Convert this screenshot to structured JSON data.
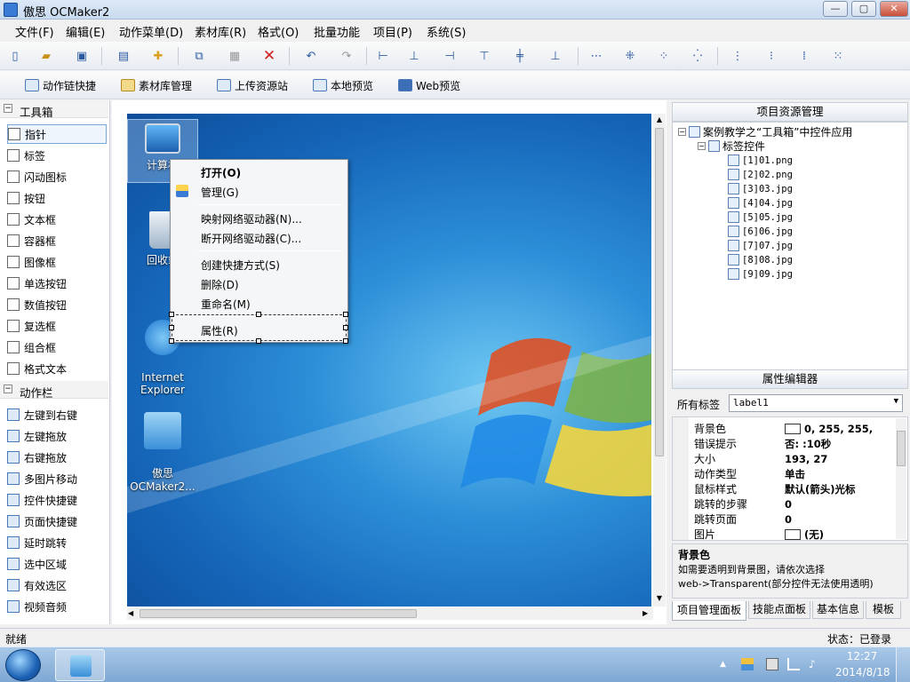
{
  "window": {
    "title": "傲思 OCMaker2"
  },
  "menu": [
    "文件(F)",
    "编辑(E)",
    "动作菜单(D)",
    "素材库(R)",
    "格式(O)",
    "批量功能",
    "项目(P)",
    "系统(S)"
  ],
  "toolbar2": [
    "动作链快捷",
    "素材库管理",
    "上传资源站",
    "本地预览",
    "Web预览"
  ],
  "toolbox": {
    "group1": "工具箱",
    "items1": [
      "指针",
      "标签",
      "闪动图标",
      "按钮",
      "文本框",
      "容器框",
      "图像框",
      "单选按钮",
      "数值按钮",
      "复选框",
      "组合框",
      "格式文本"
    ],
    "icons1": [
      "pointer-icon",
      "label-icon",
      "flash-icon",
      "button-icon",
      "textbox-icon",
      "container-icon",
      "image-icon",
      "radio-icon",
      "number-icon",
      "checkbox-icon",
      "combo-icon",
      "richtext-icon"
    ],
    "group2": "动作栏",
    "items2": [
      "左键到右键",
      "左键拖放",
      "右键拖放",
      "多图片移动",
      "控件快捷键",
      "页面快捷键",
      "延时跳转",
      "选中区域",
      "有效选区",
      "视频音频"
    ]
  },
  "desktop": {
    "icons": [
      "计算机",
      "回收站",
      "Internet\nExplorer",
      "傲思\nOCMaker2..."
    ]
  },
  "context_menu": {
    "items": [
      "打开(O)",
      "管理(G)",
      "映射网络驱动器(N)...",
      "断开网络驱动器(C)...",
      "创建快捷方式(S)",
      "删除(D)",
      "重命名(M)",
      "属性(R)"
    ]
  },
  "project_panel": {
    "title": "项目资源管理",
    "root": "案例教学之“工具箱”中控件应用",
    "child": "标签控件",
    "files": [
      "[1]01.png",
      "[2]02.png",
      "[3]03.jpg",
      "[4]04.jpg",
      "[5]05.jpg",
      "[6]06.jpg",
      "[7]07.jpg",
      "[8]08.jpg",
      "[9]09.jpg"
    ]
  },
  "property_panel": {
    "title": "属性编辑器",
    "selector_label": "所有标签",
    "selector_value": "label1",
    "rows": [
      {
        "k": "背景色",
        "v": "0, 255, 255,"
      },
      {
        "k": "错误提示",
        "v": "否: :10秒"
      },
      {
        "k": "大小",
        "v": "193, 27"
      },
      {
        "k": "动作类型",
        "v": "单击"
      },
      {
        "k": "鼠标样式",
        "v": "默认(箭头)光标"
      },
      {
        "k": "跳转的步骤",
        "v": "0"
      },
      {
        "k": "跳转页面",
        "v": "0"
      },
      {
        "k": "图片",
        "v": "(无)"
      }
    ],
    "desc_title": "背景色",
    "desc_text": "如需要透明到背景图，请依次选择\nweb->Transparent(部分控件无法使用透明)",
    "tabs": [
      "项目管理面板",
      "技能点面板",
      "基本信息",
      "模板"
    ]
  },
  "status": {
    "left": "就绪",
    "right": "状态：已登录"
  },
  "taskbar": {
    "time": "12:27",
    "date": "2014/8/18"
  }
}
